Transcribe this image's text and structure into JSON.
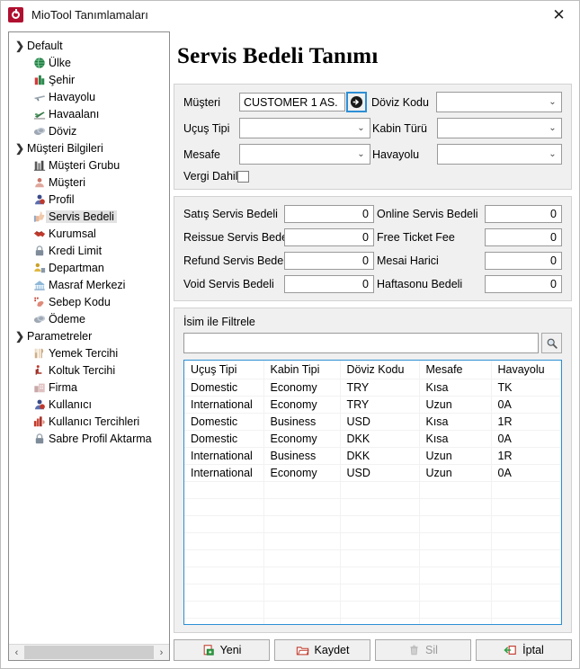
{
  "window": {
    "title": "MioTool Tanımlamaları",
    "close_label": "✕",
    "app_icon": "miotool-logo-icon"
  },
  "sidebar": {
    "items": [
      {
        "label": "Default",
        "icon": "chevron-right-icon",
        "level": 0,
        "selected": false
      },
      {
        "label": "Ülke",
        "icon": "globe-icon",
        "level": 1,
        "selected": false
      },
      {
        "label": "Şehir",
        "icon": "city-buildings-icon",
        "level": 1,
        "selected": false
      },
      {
        "label": "Havayolu",
        "icon": "airline-icon",
        "level": 1,
        "selected": false
      },
      {
        "label": "Havaalanı",
        "icon": "airport-icon",
        "level": 1,
        "selected": false
      },
      {
        "label": "Döviz",
        "icon": "currency-coins-icon",
        "level": 1,
        "selected": false
      },
      {
        "label": "Müşteri Bilgileri",
        "icon": "chevron-right-icon",
        "level": 0,
        "selected": false
      },
      {
        "label": "Müşteri Grubu",
        "icon": "customer-group-icon",
        "level": 1,
        "selected": false
      },
      {
        "label": "Müşteri",
        "icon": "customer-icon",
        "level": 1,
        "selected": false
      },
      {
        "label": "Profil",
        "icon": "profile-icon",
        "level": 1,
        "selected": false
      },
      {
        "label": "Servis Bedeli",
        "icon": "service-fee-icon",
        "level": 1,
        "selected": true
      },
      {
        "label": "Kurumsal",
        "icon": "handshake-icon",
        "level": 1,
        "selected": false
      },
      {
        "label": "Kredi Limit",
        "icon": "lock-icon",
        "level": 1,
        "selected": false
      },
      {
        "label": "Departman",
        "icon": "department-icon",
        "level": 1,
        "selected": false
      },
      {
        "label": "Masraf Merkezi",
        "icon": "cost-center-icon",
        "level": 1,
        "selected": false
      },
      {
        "label": "Sebep Kodu",
        "icon": "reason-code-icon",
        "level": 1,
        "selected": false
      },
      {
        "label": "Ödeme",
        "icon": "payment-icon",
        "level": 1,
        "selected": false
      },
      {
        "label": "Parametreler",
        "icon": "chevron-right-icon",
        "level": 0,
        "selected": false
      },
      {
        "label": "Yemek Tercihi",
        "icon": "meal-icon",
        "level": 1,
        "selected": false
      },
      {
        "label": "Koltuk Tercihi",
        "icon": "seat-icon",
        "level": 1,
        "selected": false
      },
      {
        "label": "Firma",
        "icon": "company-icon",
        "level": 1,
        "selected": false
      },
      {
        "label": "Kullanıcı",
        "icon": "user-icon",
        "level": 1,
        "selected": false
      },
      {
        "label": "Kullanıcı Tercihleri",
        "icon": "user-prefs-icon",
        "level": 1,
        "selected": false
      },
      {
        "label": "Sabre Profil Aktarma",
        "icon": "lock-transfer-icon",
        "level": 1,
        "selected": false
      }
    ],
    "hscroll": {
      "left_arrow": "‹",
      "right_arrow": "›"
    }
  },
  "main": {
    "page_title": "Servis Bedeli Tanımı",
    "form": {
      "musteri_label": "Müşteri",
      "musteri_value": "CUSTOMER 1 AS.",
      "musteri_picker_icon": "arrow-right-circle-icon",
      "doviz_kodu_label": "Döviz Kodu",
      "doviz_kodu_value": "",
      "ucus_tipi_label": "Uçuş Tipi",
      "ucus_tipi_value": "",
      "kabin_turu_label": "Kabin Türü",
      "kabin_turu_value": "",
      "mesafe_label": "Mesafe",
      "mesafe_value": "",
      "havayolu_label": "Havayolu",
      "havayolu_value": "",
      "vergi_dahil_label": "Vergi Dahil",
      "vergi_dahil_checked": false
    },
    "fees": {
      "satis_servis_bedeli_label": "Satış Servis Bedeli",
      "satis_servis_bedeli_value": "0",
      "online_servis_bedeli_label": "Online Servis Bedeli",
      "online_servis_bedeli_value": "0",
      "reissue_servis_bedeli_label": "Reissue Servis Bedeli",
      "reissue_servis_bedeli_value": "0",
      "free_ticket_fee_label": "Free Ticket Fee",
      "free_ticket_fee_value": "0",
      "refund_servis_bedeli_label": "Refund Servis Bedeli",
      "refund_servis_bedeli_value": "0",
      "mesai_harici_label": "Mesai Harici",
      "mesai_harici_value": "0",
      "void_servis_bedeli_label": "Void Servis Bedeli",
      "void_servis_bedeli_value": "0",
      "haftasonu_bedeli_label": "Haftasonu Bedeli",
      "haftasonu_bedeli_value": "0"
    },
    "filter": {
      "label": "İsim ile Filtrele",
      "value": "",
      "placeholder": "",
      "search_icon": "magnifier-icon"
    },
    "grid": {
      "columns": [
        "Uçuş Tipi",
        "Kabin Tipi",
        "Döviz Kodu",
        "Mesafe",
        "Havayolu"
      ],
      "rows": [
        [
          "Domestic",
          "Economy",
          "TRY",
          "Kısa",
          "TK"
        ],
        [
          "International",
          "Economy",
          "TRY",
          "Uzun",
          "0A"
        ],
        [
          "Domestic",
          "Business",
          "USD",
          "Kısa",
          "1R"
        ],
        [
          "Domestic",
          "Economy",
          "DKK",
          "Kısa",
          "0A"
        ],
        [
          "International",
          "Business",
          "DKK",
          "Uzun",
          "1R"
        ],
        [
          "International",
          "Economy",
          "USD",
          "Uzun",
          "0A"
        ]
      ],
      "empty_rows": 9
    },
    "buttons": [
      {
        "label": "Yeni",
        "icon": "new-document-icon",
        "disabled": false
      },
      {
        "label": "Kaydet",
        "icon": "save-folder-icon",
        "disabled": false
      },
      {
        "label": "Sil",
        "icon": "trash-icon",
        "disabled": true
      },
      {
        "label": "İptal",
        "icon": "cancel-exit-icon",
        "disabled": false
      }
    ]
  },
  "colors": {
    "accent_blue": "#2d8fd5",
    "panel_gray": "#f0f0f0",
    "app_red": "#b01030",
    "selected_row": "#e2e2e2"
  }
}
